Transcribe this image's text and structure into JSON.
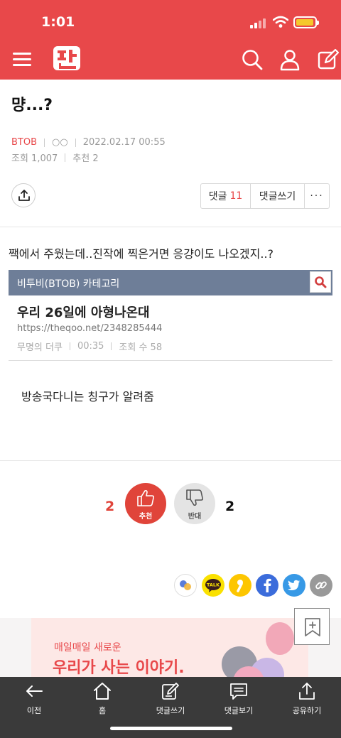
{
  "status": {
    "time": "1:01"
  },
  "post": {
    "title": "먕...?",
    "category": "BTOB",
    "author": "○○",
    "datetime": "2022.02.17 00:55",
    "views_label": "조회 1,007",
    "recommend_label": "추천 2"
  },
  "actions": {
    "comments_label": "댓글",
    "comments_count": "11",
    "write_comment_label": "댓글쓰기",
    "more_label": "···"
  },
  "content": {
    "text1": "짹에서 주웠는데..진작에 찍은거면 응걍이도 나오겠지..?",
    "embed": {
      "category": "비투비(BTOB) 카테고리",
      "title": "우리 26일에 아형나온대",
      "url": "https://theqoo.net/2348285444",
      "author": "무명의 더쿠",
      "time": "00:35",
      "views": "조회 수 58"
    },
    "text2": "방송국다니는 칭구가 알려줌"
  },
  "votes": {
    "up_count": "2",
    "up_label": "추천",
    "down_count": "2",
    "down_label": "반대"
  },
  "share": {
    "icons": [
      "kakaostory-icon",
      "kakaotalk-icon",
      "pinkstory-icon",
      "facebook-icon",
      "twitter-icon",
      "link-icon"
    ],
    "talk_label": "TALK",
    "colors": {
      "kakao": "#fae100",
      "facebook": "#3b6cdb",
      "twitter": "#3799e6",
      "link": "#999999"
    }
  },
  "ad": {
    "line1": "매일매일 새로운",
    "line2": "우리가 사는 이야기."
  },
  "bottom_nav": [
    {
      "label": "이전"
    },
    {
      "label": "홈"
    },
    {
      "label": "댓글쓰기"
    },
    {
      "label": "댓글보기"
    },
    {
      "label": "공유하기"
    }
  ],
  "colors": {
    "brand": "#e8484a",
    "upvote": "#e0443a",
    "embed_bar": "#6e7e98",
    "bottom_bar": "#3a3a3a"
  }
}
